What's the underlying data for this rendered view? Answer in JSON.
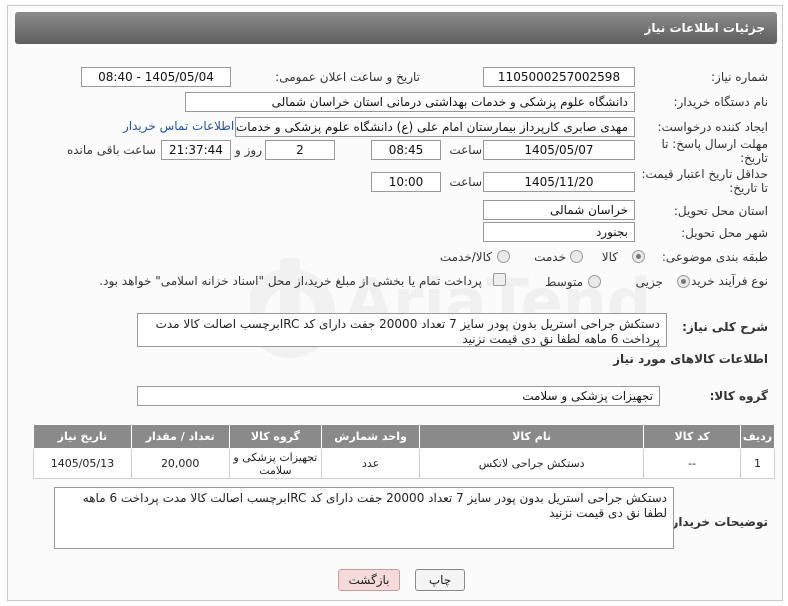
{
  "header": {
    "title": "جزئیات اطلاعات نیاز"
  },
  "fields": {
    "need_number": {
      "label": "شماره نیاز:",
      "value": "1105000257002598"
    },
    "announce": {
      "label": "تاریخ و ساعت اعلان عمومی:",
      "value": "1405/05/04 - 08:40"
    },
    "buyer_org": {
      "label": "نام دستگاه خریدار:",
      "value": "دانشگاه علوم پزشکی و خدمات بهداشتی درمانی استان خراسان شمالی"
    },
    "requester": {
      "label": "ایجاد کننده درخواست:",
      "value": "مهدی صابری کارپرداز بیمارستان امام علی (ع) دانشگاه علوم پزشکی و خدمات بهداشتی",
      "contact_link": "اطلاعات تماس خریدار"
    },
    "deadline": {
      "label_line1": "مهلت ارسال پاسخ: تا",
      "label_line2": "تاریخ:",
      "date": "1405/05/07",
      "time_label": "ساعت",
      "time": "08:45",
      "days": "2",
      "days_label": "روز و",
      "remaining": "21:37:44",
      "remaining_label": "ساعت باقی مانده"
    },
    "validity": {
      "label_line1": "حداقل تاریخ اعتبار قیمت:",
      "label_line2": "تا تاریخ:",
      "date": "1405/11/20",
      "time_label": "ساعت",
      "time": "10:00"
    },
    "province": {
      "label": "استان محل تحویل:",
      "value": "خراسان شمالی"
    },
    "city": {
      "label": "شهر محل تحویل:",
      "value": "بجنورد"
    },
    "category": {
      "label": "طبقه بندی موضوعی:",
      "options": [
        "کالا",
        "خدمت",
        "کالا/خدمت"
      ],
      "selected": "کالا"
    },
    "process": {
      "label": "نوع فرآیند خرید :",
      "options": [
        "جزیی",
        "متوسط"
      ],
      "selected": "جزیی",
      "payment_note": "پرداخت تمام یا بخشی از مبلغ خرید،از محل \"اسناد خزانه اسلامی\" خواهد بود."
    }
  },
  "description": {
    "label": "شرح کلی نیاز:",
    "value": "دستکش جراحی  استریل بدون پودر سایز 7 تعداد 20000 جفت دارای کد IRCبرچسب اصالت کالا مدت پرداخت 6 ماهه لطفا نق دی قیمت نزنید"
  },
  "goods_info": {
    "title": "اطلاعات کالاهای مورد نیاز"
  },
  "goods_group": {
    "label": "گروه کالا:",
    "value": "تجهیزات پزشکی و سلامت"
  },
  "table": {
    "headers": [
      "ردیف",
      "کد کالا",
      "نام کالا",
      "واحد شمارش",
      "گروه کالا",
      "تعداد / مقدار",
      "تاریخ نیاز"
    ],
    "rows": [
      [
        "1",
        "--",
        "دستکش جراحی لاتکس",
        "عدد",
        "تجهیزات پزشکی و سلامت",
        "20,000",
        "1405/05/13"
      ]
    ]
  },
  "buyer_notes": {
    "label": "توضیحات خریدار:",
    "value": "دستکش جراحی  استریل بدون پودر سایز 7 تعداد 20000 جفت دارای کد IRCبرچسب اصالت کالا مدت پرداخت 6 ماهه لطفا نق دی قیمت نزنید"
  },
  "buttons": {
    "print": "چاپ",
    "back": "بازگشت"
  },
  "watermark": {
    "text": "AriaTender.net"
  },
  "colors": {
    "header": "#6f6f6f",
    "link": "#2255aa",
    "back_button": "#f6dada"
  }
}
